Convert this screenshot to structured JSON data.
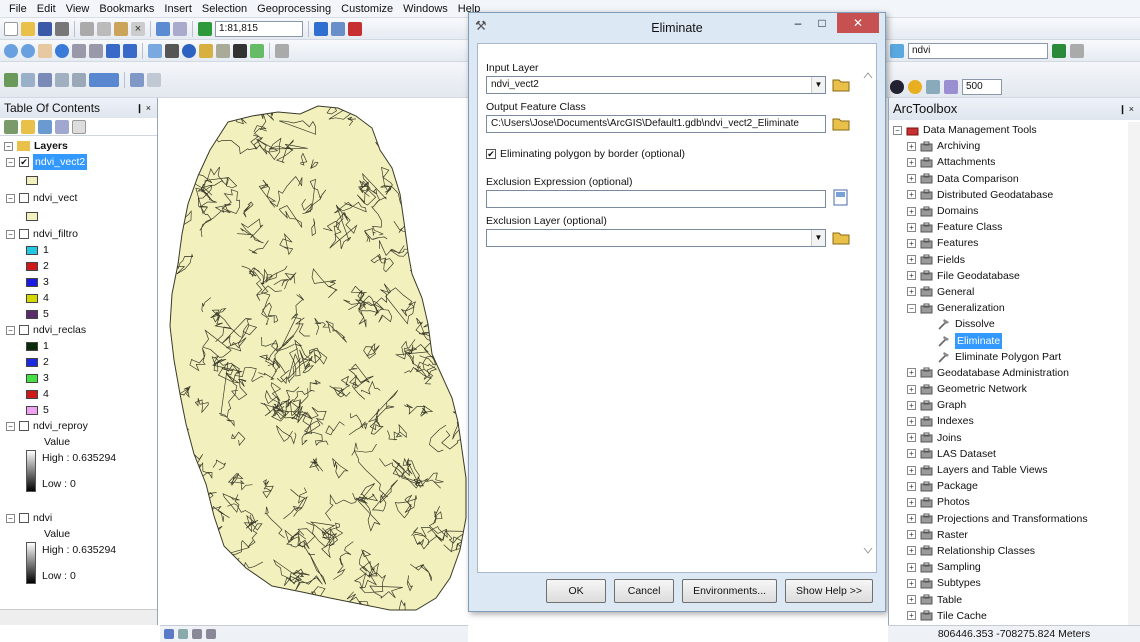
{
  "menu": [
    "File",
    "Edit",
    "View",
    "Bookmarks",
    "Insert",
    "Selection",
    "Geoprocessing",
    "Customize",
    "Windows",
    "Help"
  ],
  "toolbar": {
    "scale": "1:81,815",
    "right_layer": "ndvi",
    "right_value": "500"
  },
  "toc": {
    "title": "Table Of Contents",
    "pin": "❙ ×",
    "root": "Layers",
    "layers": [
      {
        "name": "ndvi_vect2",
        "checked": true,
        "selected": true
      },
      {
        "name": "ndvi_vect",
        "checked": false
      },
      {
        "name": "ndvi_filtro",
        "checked": false,
        "classes": [
          "1",
          "2",
          "3",
          "4",
          "5"
        ]
      },
      {
        "name": "ndvi_reclas",
        "checked": false,
        "classes": [
          "1",
          "2",
          "3",
          "4",
          "5"
        ]
      },
      {
        "name": "ndvi_reproy",
        "checked": false,
        "value_label": "Value",
        "high": "High : 0.635294",
        "low": "Low : 0"
      },
      {
        "name": "ndvi",
        "checked": false,
        "value_label": "Value",
        "high": "High : 0.635294",
        "low": "Low : 0"
      }
    ],
    "colors": {
      "filtro": [
        "#22c8e0",
        "#cc1a1a",
        "#1a1ae0",
        "#d6d600",
        "#5a2a6a"
      ],
      "reclas": [
        "#0a2a0a",
        "#1a2ae0",
        "#46e046",
        "#cc1a1a",
        "#f0a0f0"
      ]
    }
  },
  "dialog": {
    "title": "Eliminate",
    "input_label": "Input Layer",
    "input_value": "ndvi_vect2",
    "output_label": "Output Feature Class",
    "output_value": "C:\\Users\\Jose\\Documents\\ArcGIS\\Default1.gdb\\ndvi_vect2_Eliminate",
    "border_label": "Eliminating polygon by border (optional)",
    "border_checked": true,
    "expr_label": "Exclusion Expression (optional)",
    "expr_value": "",
    "excl_layer_label": "Exclusion Layer (optional)",
    "excl_layer_value": "",
    "buttons": {
      "ok": "OK",
      "cancel": "Cancel",
      "env": "Environments...",
      "help": "Show Help >>"
    },
    "minimize": "–",
    "restore": "□",
    "close": "✕"
  },
  "arctoolbox": {
    "title": "ArcToolbox",
    "pin": "❙ ×",
    "root": "Data Management Tools",
    "items": [
      "Archiving",
      "Attachments",
      "Data Comparison",
      "Distributed Geodatabase",
      "Domains",
      "Feature Class",
      "Features",
      "Fields",
      "File Geodatabase",
      "General"
    ],
    "generalization": "Generalization",
    "gen_tools": [
      "Dissolve",
      "Eliminate",
      "Eliminate Polygon Part"
    ],
    "selected_tool": "Eliminate",
    "items2": [
      "Geodatabase Administration",
      "Geometric Network",
      "Graph",
      "Indexes",
      "Joins",
      "LAS Dataset",
      "Layers and Table Views",
      "Package",
      "Photos",
      "Projections and Transformations",
      "Raster",
      "Relationship Classes",
      "Sampling",
      "Subtypes",
      "Table",
      "Tile Cache"
    ]
  },
  "status": {
    "coords": "806446.353  -708275.824 Meters"
  },
  "map": {
    "fill": "#f2f1be",
    "stroke": "#3a3a2a"
  }
}
